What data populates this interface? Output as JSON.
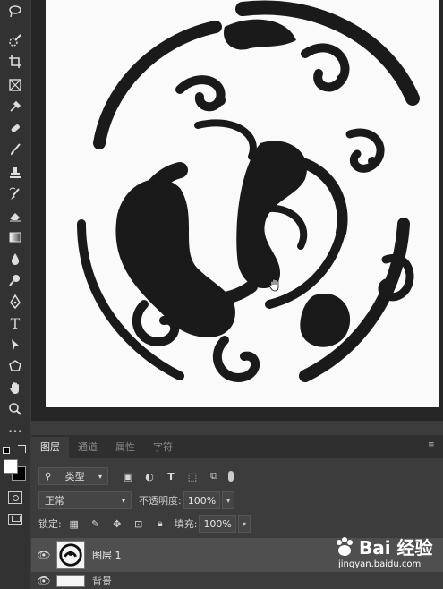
{
  "toolbar": {
    "tools": [
      "lasso-icon",
      "quick-select-icon",
      "crop-icon",
      "frame-icon",
      "eyedropper-icon",
      "healing-brush-icon",
      "brush-icon",
      "stamp-icon",
      "history-brush-icon",
      "eraser-icon",
      "gradient-icon",
      "blur-icon",
      "dodge-icon",
      "pen-icon",
      "type-icon",
      "path-select-icon",
      "shape-icon",
      "hand-icon",
      "zoom-icon",
      "more-icon"
    ],
    "type_glyph": "T",
    "more_glyph": "•••"
  },
  "panel": {
    "tabs": [
      {
        "label": "图层",
        "active": true
      },
      {
        "label": "通道",
        "active": false
      },
      {
        "label": "属性",
        "active": false
      },
      {
        "label": "字符",
        "active": false
      }
    ],
    "filter": {
      "label": "类型"
    },
    "blend_mode": "正常",
    "opacity_label": "不透明度:",
    "opacity_value": "100%",
    "lock_label": "锁定:",
    "fill_label": "填充:",
    "fill_value": "100%",
    "layers": [
      {
        "name": "图层 1",
        "selected": true
      },
      {
        "name": "背景",
        "selected": false
      }
    ]
  },
  "watermark": {
    "text": "Bai 经验",
    "url": "jingyan.baidu.com"
  }
}
